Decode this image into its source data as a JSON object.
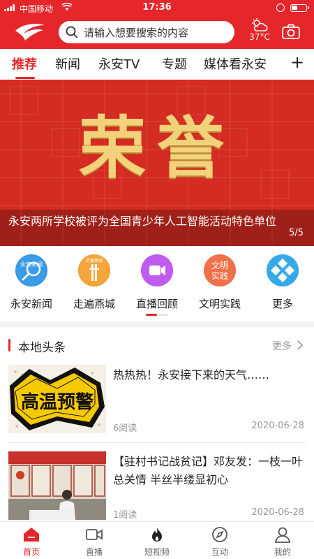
{
  "status_bar": {
    "carrier": "中国移动",
    "time": "17:36"
  },
  "header": {
    "search_placeholder": "请输入想要搜索的内容",
    "temperature": "37°C",
    "accent_color": "#e5262b"
  },
  "tabs": {
    "items": [
      {
        "label": "推荐",
        "active": true
      },
      {
        "label": "新闻",
        "active": false
      },
      {
        "label": "永安TV",
        "active": false
      },
      {
        "label": "专题",
        "active": false
      },
      {
        "label": "媒体看永安",
        "active": false
      }
    ],
    "more_label": "+"
  },
  "banner": {
    "hero_text": "荣誉",
    "caption": "永安两所学校被评为全国青少年人工智能活动特色单位",
    "counter": "5/5",
    "current_slide": 5,
    "total_slides": 5
  },
  "shortcuts": {
    "items": [
      {
        "label": "永安新闻",
        "icon": "yongan-news-icon",
        "badge_text": "永安新闻"
      },
      {
        "label": "走遍燕城",
        "icon": "city-landmark-icon",
        "badge_text": "走遍燕城"
      },
      {
        "label": "直播回顾",
        "icon": "video-camera-icon"
      },
      {
        "label": "文明实践",
        "icon": "civilization-practice-icon",
        "badge_text_line1": "文明",
        "badge_text_line2": "实践"
      },
      {
        "label": "更多",
        "icon": "more-grid-icon"
      }
    ],
    "page_indicator": {
      "current": 1,
      "total": 2
    }
  },
  "local_news": {
    "title": "本地头条",
    "more_label": "更多",
    "articles": [
      {
        "title": "热热热！永安接下来的天气……",
        "reads": "6阅读",
        "date": "2020-06-28",
        "thumb_text": "高温预警"
      },
      {
        "title": "【驻村书记战贫记】邓友发：一枝一叶总关情 半丝半缕显初心",
        "reads": "1阅读",
        "date": "2020-06-28"
      }
    ]
  },
  "bottom_nav": {
    "items": [
      {
        "label": "首页",
        "icon": "home-icon",
        "active": true
      },
      {
        "label": "直播",
        "icon": "live-video-icon",
        "active": false
      },
      {
        "label": "短视频",
        "icon": "flame-icon",
        "active": false
      },
      {
        "label": "互动",
        "icon": "compass-icon",
        "active": false
      },
      {
        "label": "我的",
        "icon": "user-icon",
        "active": false
      }
    ]
  }
}
